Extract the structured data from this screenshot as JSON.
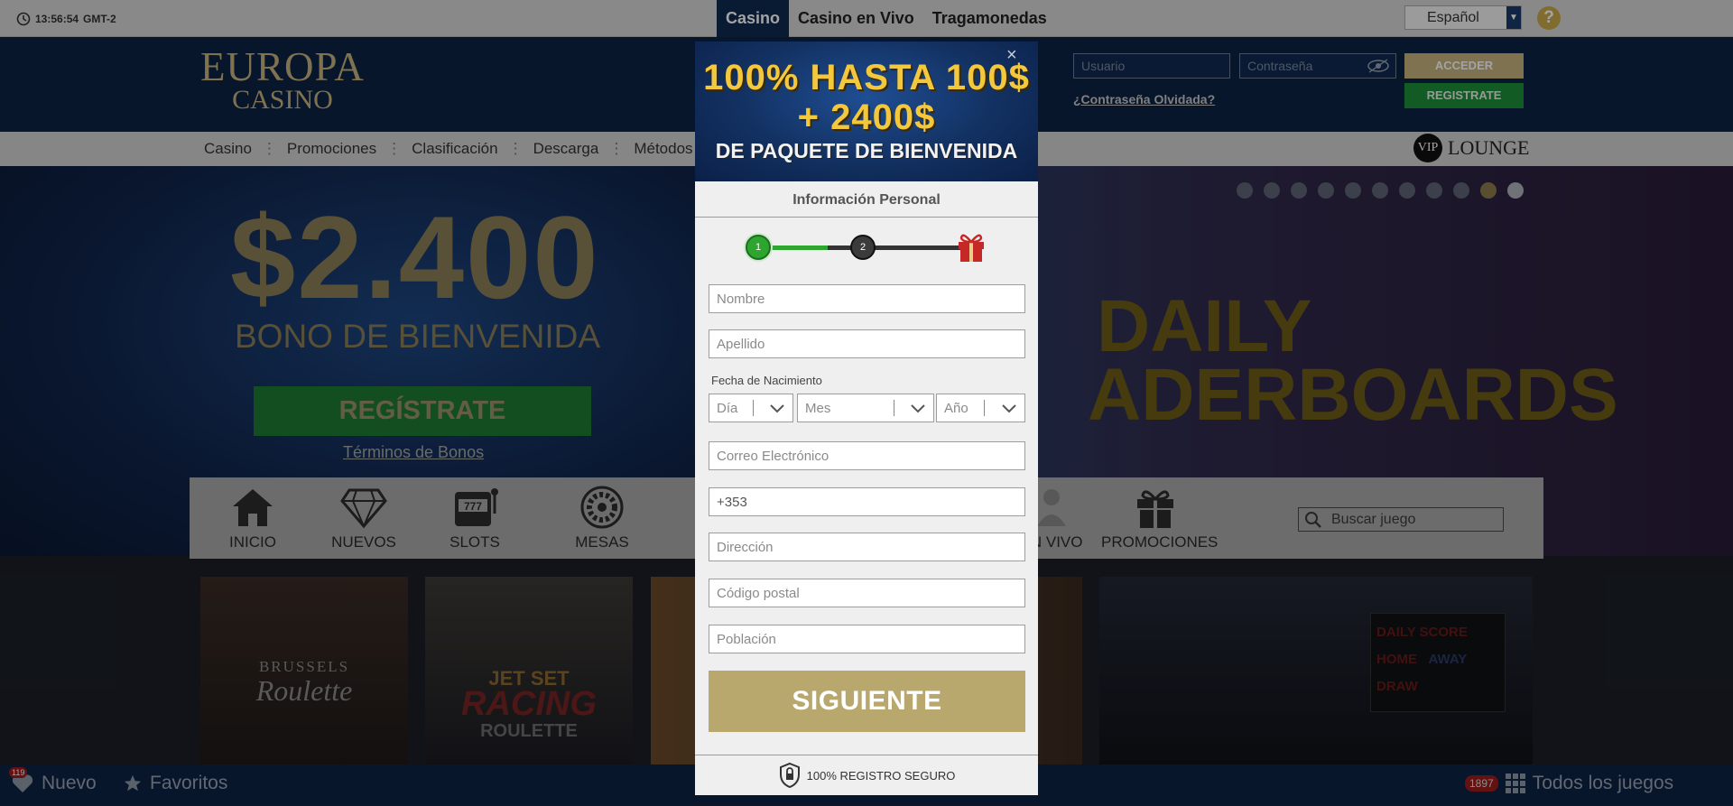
{
  "topbar": {
    "time": "13:56:54",
    "timezone": "GMT-2",
    "nav": [
      "Casino",
      "Casino en Vivo",
      "Tragamonedas"
    ],
    "active_nav": "Casino",
    "language": "Español",
    "help": "?"
  },
  "header": {
    "logo_line1": "EUROPA",
    "logo_line2": "CASINO",
    "username_placeholder": "Usuario",
    "password_placeholder": "Contraseña",
    "login_button": "ACCEDER",
    "register_button": "REGISTRATE",
    "forgot_link": "¿Contraseña Olvidada?"
  },
  "subnav": {
    "items": [
      "Casino",
      "Promociones",
      "Clasificación",
      "Descarga",
      "Métodos de"
    ],
    "vip_badge": "VIP",
    "vip_text": "LOUNGE"
  },
  "hero": {
    "amount": "$2.400",
    "subtitle": "BONO DE BIENVENIDA",
    "cta": "REGÍSTRATE",
    "terms": "Términos de Bonos",
    "right_title_1": "DAILY",
    "right_title_2": "ADERBOARDS",
    "slide_count": 11,
    "active_slide": 10
  },
  "categories": [
    {
      "label": "INICIO",
      "icon": "home-icon"
    },
    {
      "label": "NUEVOS",
      "icon": "diamond-icon"
    },
    {
      "label": "SLOTS",
      "icon": "slot-machine-icon"
    },
    {
      "label": "MESAS",
      "icon": "roulette-icon"
    },
    {
      "label": "EN VIVO",
      "icon": "dealer-icon"
    },
    {
      "label": "PROMOCIONES",
      "icon": "gift-icon"
    }
  ],
  "search": {
    "placeholder": "Buscar juego"
  },
  "thumbs": {
    "t1_line1": "BRUSSELS",
    "t1_line2": "Roulette",
    "t2_line1": "JET SET",
    "t2_line2": "RACING",
    "t2_line3": "ROULETTE",
    "t4_score_title": "DAILY SCORE",
    "t4_home": "HOME",
    "t4_away": "AWAY",
    "t4_draw": "DRAW"
  },
  "bottombar": {
    "new_count": "119",
    "new_label": "Nuevo",
    "fav_label": "Favoritos",
    "all_count": "1897",
    "all_label": "Todos los juegos"
  },
  "modal": {
    "banner_line1": "100% HASTA 100$",
    "banner_line2": "+ 2400$",
    "banner_line3": "DE PAQUETE DE BIENVENIDA",
    "close": "×",
    "section_title": "Información Personal",
    "step1": "1",
    "step2": "2",
    "progress_fraction": 0.35,
    "fields": {
      "nombre": "Nombre",
      "apellido": "Apellido",
      "dob_label": "Fecha de Nacimiento",
      "dia": "Día",
      "mes": "Mes",
      "ano": "Año",
      "correo": "Correo Electrónico",
      "telefono": "+353",
      "direccion": "Dirección",
      "codigo_postal": "Código postal",
      "poblacion": "Población"
    },
    "next_button": "SIGUIENTE",
    "secure_text": "100% REGISTRO SEGURO"
  }
}
